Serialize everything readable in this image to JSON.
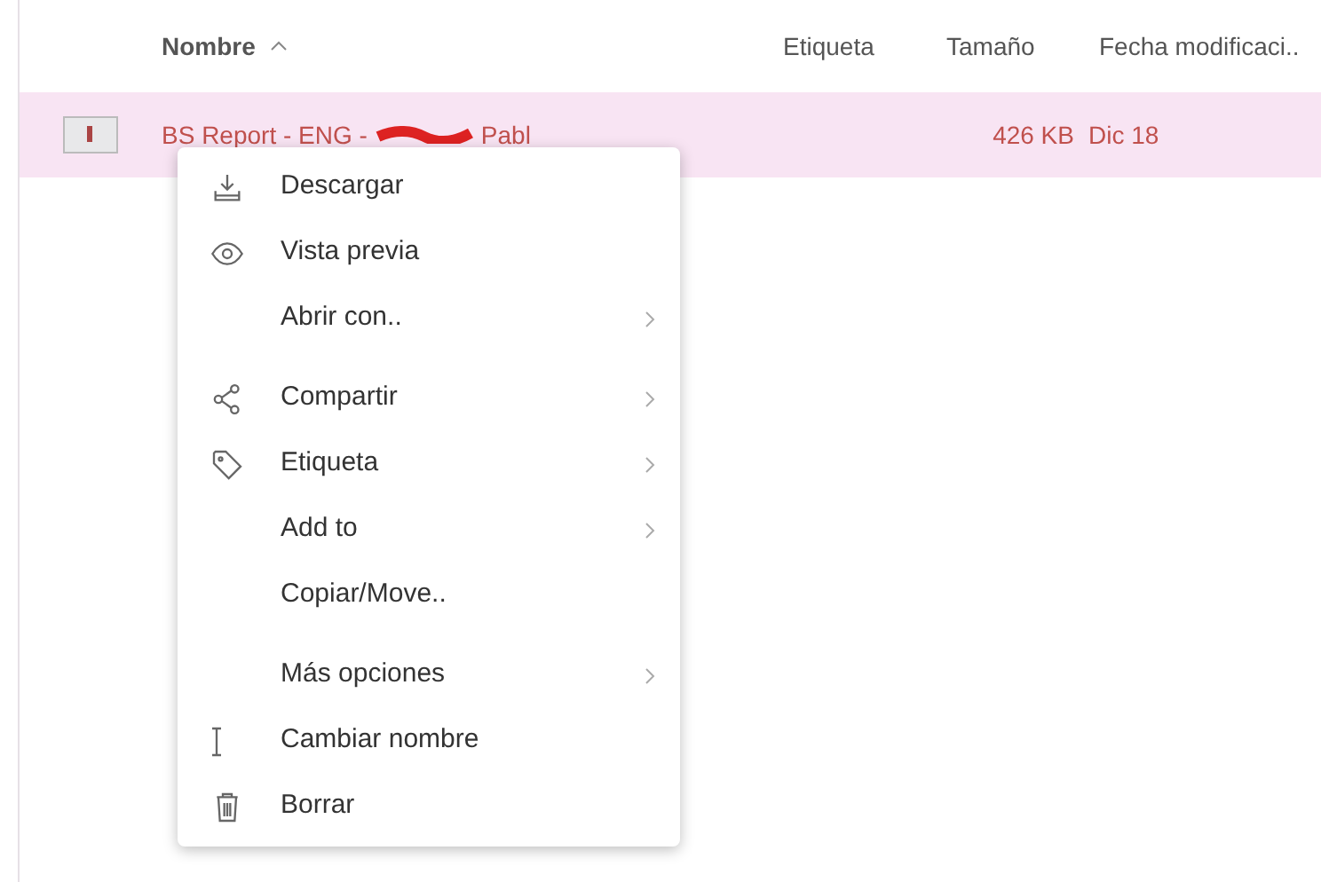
{
  "table": {
    "columns": [
      {
        "label": "Nombre",
        "sorted": true
      },
      {
        "label": "Etiqueta",
        "sorted": false
      },
      {
        "label": "Tamaño",
        "sorted": false
      },
      {
        "label": "Fecha modificaci.."
      }
    ],
    "rows": [
      {
        "selected": true,
        "name_start": "BS Report - ENG -",
        "name_end": "Pabl",
        "size": "426 KB",
        "date": "Dic 18"
      }
    ]
  },
  "context_menu": {
    "groups": [
      [
        {
          "label": "Descargar",
          "submenu": false
        },
        {
          "label": "Vista previa",
          "submenu": false
        },
        {
          "label": "Abrir con..",
          "submenu": true
        }
      ],
      [
        {
          "label": "Compartir",
          "submenu": true
        },
        {
          "label": "Etiqueta",
          "submenu": true
        },
        {
          "label": "Add to",
          "submenu": true
        },
        {
          "label": "Copiar/Move..",
          "submenu": false
        }
      ],
      [
        {
          "label": "Más opciones",
          "submenu": true
        },
        {
          "label": "Cambiar nombre",
          "submenu": false
        },
        {
          "label": "Borrar",
          "submenu": false
        }
      ]
    ]
  }
}
